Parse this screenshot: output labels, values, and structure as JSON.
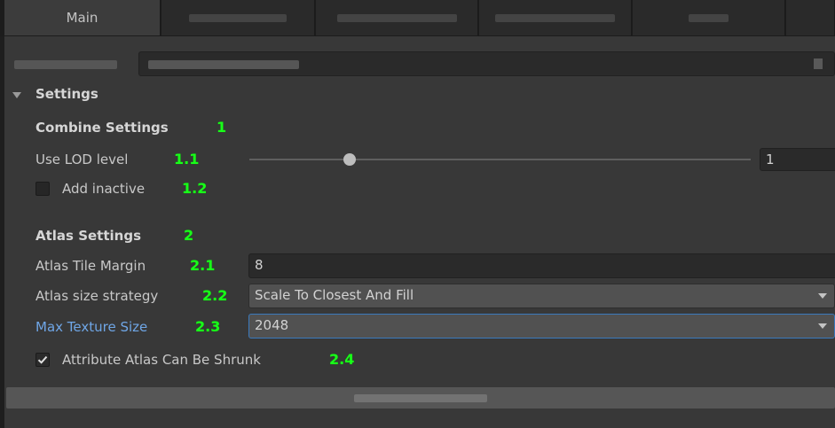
{
  "tabs": [
    {
      "label": "Main",
      "active": true
    }
  ],
  "settings": {
    "title": "Settings",
    "combine": {
      "heading": "Combine Settings",
      "heading_num": "1",
      "lod_label": "Use LOD level",
      "lod_num": "1.1",
      "lod_value": "1",
      "lod_slider_fraction": 0.2,
      "add_inactive_label": "Add inactive",
      "add_inactive_num": "1.2",
      "add_inactive_checked": false
    },
    "atlas": {
      "heading": "Atlas Settings",
      "heading_num": "2",
      "tile_margin_label": "Atlas Tile Margin",
      "tile_margin_num": "2.1",
      "tile_margin_value": "8",
      "size_strategy_label": "Atlas size strategy",
      "size_strategy_num": "2.2",
      "size_strategy_value": "Scale To Closest And Fill",
      "max_texture_label": "Max Texture Size",
      "max_texture_num": "2.3",
      "max_texture_value": "2048",
      "can_shrink_label": "Attribute Atlas Can Be Shrunk",
      "can_shrink_num": "2.4",
      "can_shrink_checked": true
    }
  },
  "colors": {
    "annotation_green": "#19ff19",
    "focus_blue": "#3a79bb",
    "label_blue": "#6fa6e6"
  }
}
